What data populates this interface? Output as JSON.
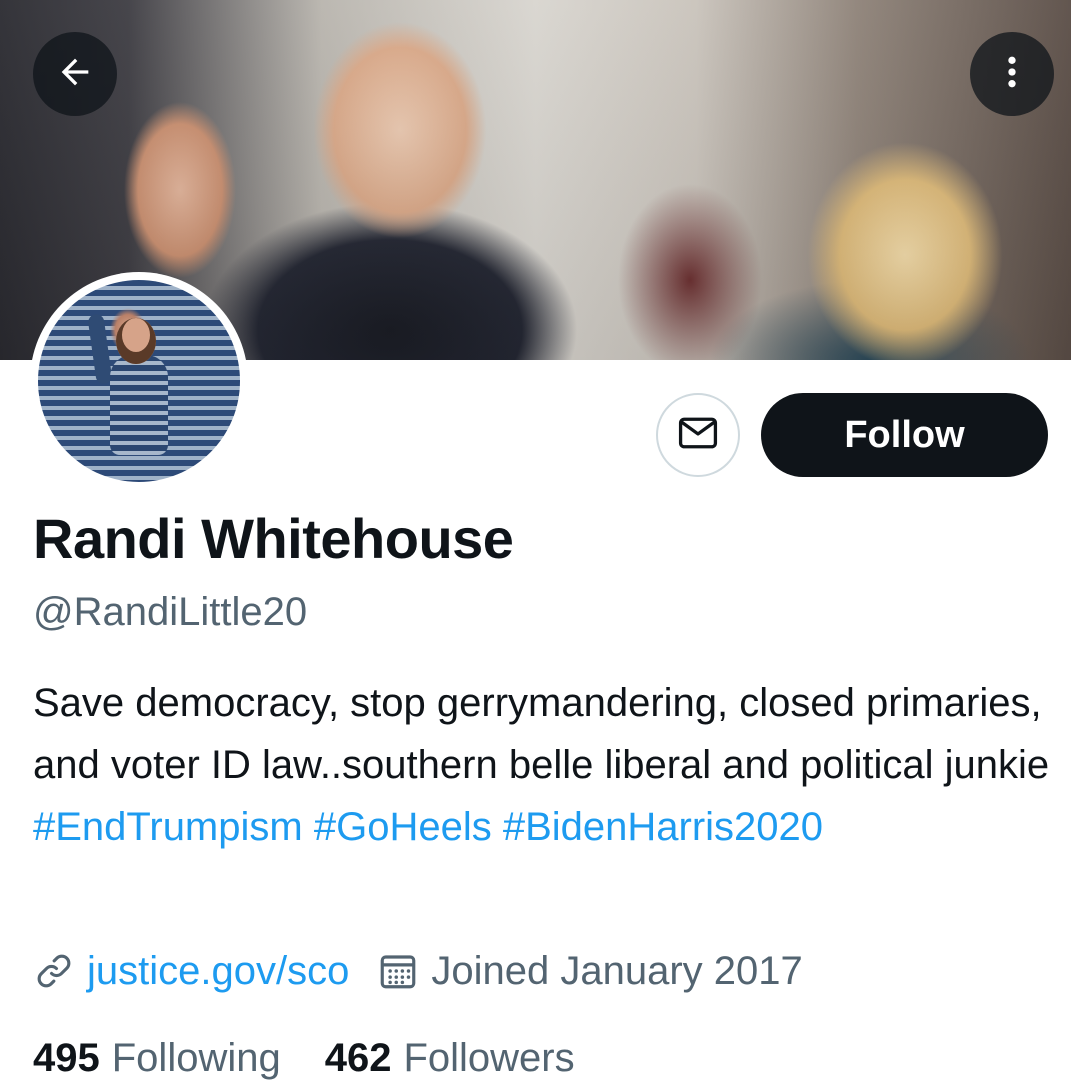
{
  "header": {
    "back_icon": "arrow-left-icon",
    "more_icon": "more-vertical-icon"
  },
  "profile": {
    "name": "Randi Whitehouse",
    "handle": "@RandiLittle20",
    "bio_text": "Save democracy, stop gerrymandering, closed primaries, and voter ID law..southern belle liberal and political junkie",
    "hashtags": [
      "#EndTrumpism",
      "#GoHeels",
      "#BidenHarris2020"
    ],
    "website": "justice.gov/sco",
    "joined": "Joined January 2017"
  },
  "actions": {
    "message_icon": "envelope-icon",
    "follow_label": "Follow"
  },
  "stats": {
    "following_count": "495",
    "following_label": "Following",
    "followers_count": "462",
    "followers_label": "Followers"
  },
  "colors": {
    "accent": "#1d9bf0",
    "text_primary": "#0f1419",
    "text_secondary": "#536471",
    "button_dark": "#0f1419"
  }
}
